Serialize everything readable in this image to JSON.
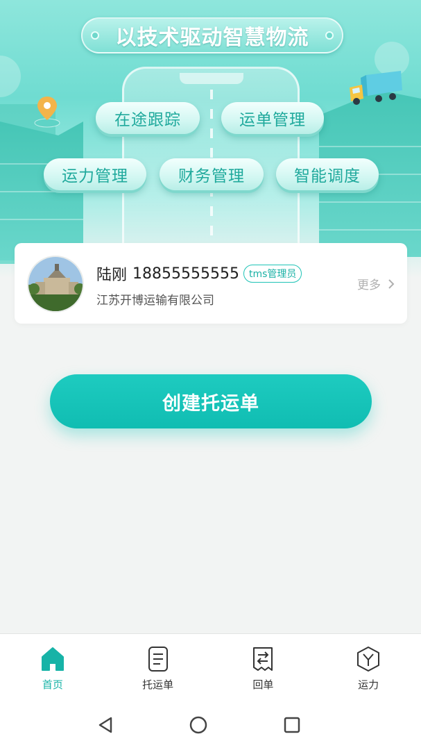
{
  "banner": {
    "slogan": "以技术驱动智慧物流",
    "features": [
      "在途跟踪",
      "运单管理",
      "运力管理",
      "财务管理",
      "智能调度"
    ]
  },
  "user": {
    "name": "陆刚",
    "phone": "18855555555",
    "role": "tms管理员",
    "company": "江苏开博运输有限公司",
    "more_label": "更多"
  },
  "actions": {
    "create_label": "创建托运单"
  },
  "tabs": [
    {
      "label": "首页",
      "icon": "home-icon",
      "active": true
    },
    {
      "label": "托运单",
      "icon": "document-icon",
      "active": false
    },
    {
      "label": "回单",
      "icon": "receipt-icon",
      "active": false
    },
    {
      "label": "运力",
      "icon": "capacity-icon",
      "active": false
    }
  ],
  "colors": {
    "accent": "#17b3a7",
    "button": "#10bdb2"
  }
}
